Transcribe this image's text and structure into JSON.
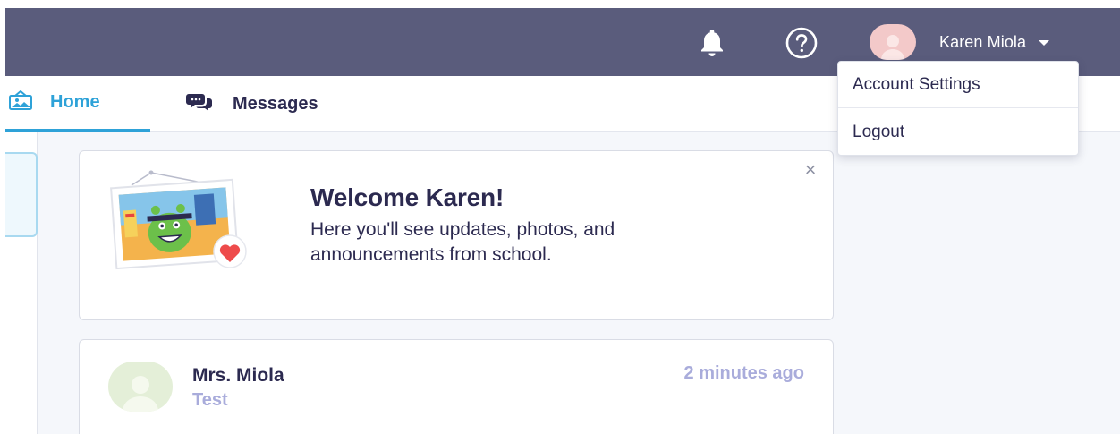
{
  "topbar": {
    "bell_icon": "bell-icon",
    "help_icon": "help-circle-icon",
    "user_name": "Karen Miola",
    "caret_icon": "caret-down-icon",
    "background": "#5a5c7c"
  },
  "nav": {
    "tabs": [
      {
        "label": "Home",
        "icon": "home-picture-icon",
        "active": true
      },
      {
        "label": "Messages",
        "icon": "chat-bubbles-icon",
        "active": false
      }
    ],
    "accent": "#2ea2d8"
  },
  "dropdown": {
    "items": [
      {
        "label": "Account Settings"
      },
      {
        "label": "Logout"
      }
    ]
  },
  "welcome": {
    "title": "Welcome Karen!",
    "body": "Here you'll see updates, photos, and announcements from school.",
    "close_icon": "close-icon"
  },
  "post": {
    "author": "Mrs. Miola",
    "text": "Test",
    "time": "2 minutes ago",
    "muted_color": "#a9acdb"
  }
}
